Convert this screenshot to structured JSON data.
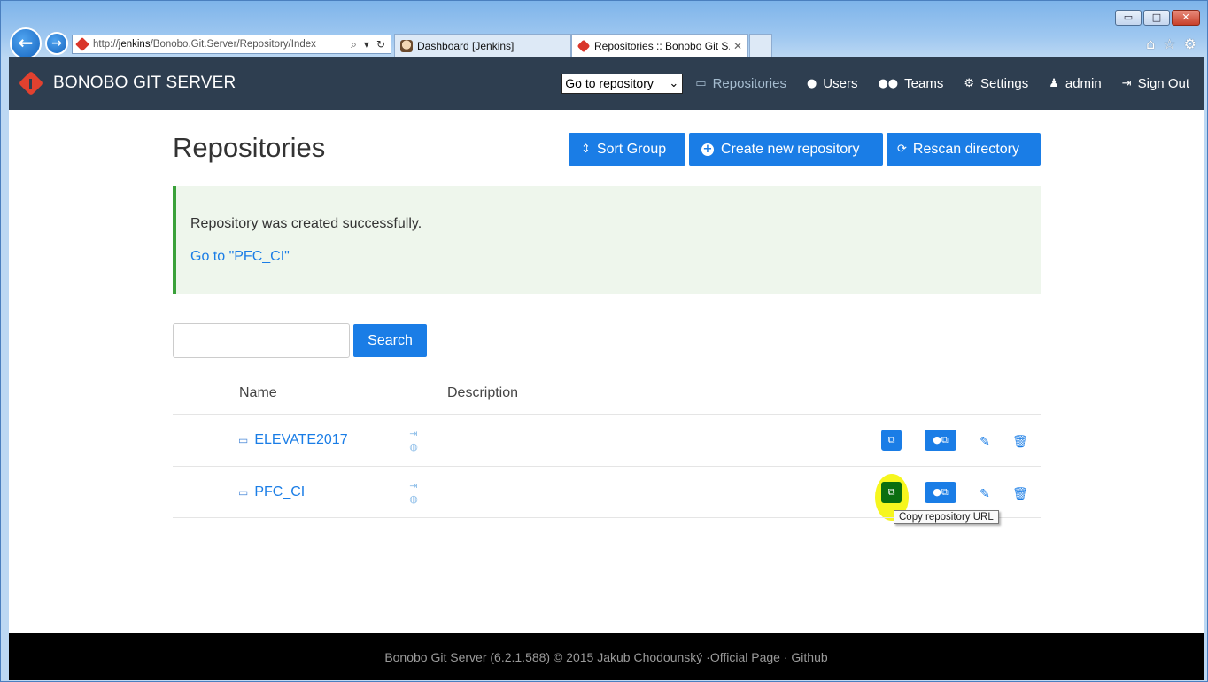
{
  "browser": {
    "address_scheme": "http://",
    "address_host": "jenkins",
    "address_path": "/Bonobo.Git.Server/Repository/Index",
    "tabs": [
      {
        "label": "Dashboard [Jenkins]"
      },
      {
        "label": "Repositories :: Bonobo Git S..."
      }
    ],
    "window_controls": {
      "minimize": "▭",
      "maximize": "□",
      "close": "✕"
    }
  },
  "navbar": {
    "brand": "BONOBO GIT SERVER",
    "repo_select": "Go to repository",
    "links": [
      {
        "label": "Repositories",
        "icon": "hdd-icon"
      },
      {
        "label": "Users",
        "icon": "user-icon"
      },
      {
        "label": "Teams",
        "icon": "users-icon"
      },
      {
        "label": "Settings",
        "icon": "cogs-icon"
      },
      {
        "label": "admin",
        "icon": "person-icon"
      },
      {
        "label": "Sign Out",
        "icon": "sign-out-icon"
      }
    ]
  },
  "page": {
    "title": "Repositories",
    "buttons": {
      "sort_group": "Sort Group",
      "create": "Create new repository",
      "rescan": "Rescan directory",
      "search": "Search"
    },
    "alert": {
      "message": "Repository was created successfully.",
      "link": "Go to \"PFC_CI\""
    },
    "search_value": "",
    "table": {
      "headers": {
        "name": "Name",
        "description": "Description"
      },
      "rows": [
        {
          "name": "ELEVATE2017",
          "description": ""
        },
        {
          "name": "PFC_CI",
          "description": ""
        }
      ]
    },
    "tooltip": "Copy repository URL"
  },
  "footer": {
    "text": "Bonobo Git Server (6.2.1.588) © 2015 Jakub Chodounský · ",
    "official": "Official Page",
    "sep": " · ",
    "github": "Github"
  },
  "colors": {
    "navbar": "#2e3e50",
    "primary": "#1a7de6",
    "alert_bg": "#eef6ec",
    "alert_border": "#3aa13a",
    "highlight": "#f6f61e"
  }
}
